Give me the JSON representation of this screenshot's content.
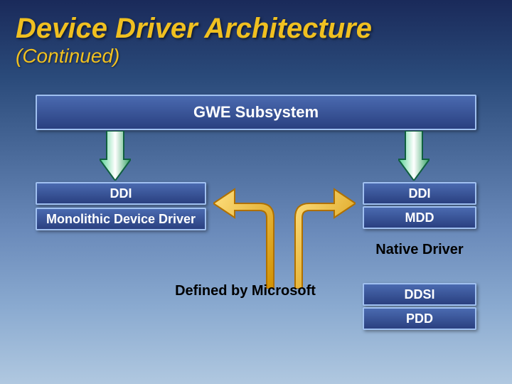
{
  "title": "Device Driver Architecture",
  "subtitle": "(Continued)",
  "blocks": {
    "gwe": "GWE Subsystem",
    "ddi_left": "DDI",
    "monolithic": "Monolithic Device Driver",
    "ddi_right": "DDI",
    "mdd": "MDD",
    "ddsi": "DDSI",
    "pdd": "PDD"
  },
  "labels": {
    "native_driver": "Native Driver",
    "defined_by_ms": "Defined by Microsoft"
  },
  "colors": {
    "arrow_fill": "#20a060",
    "arrow_stroke": "#106040",
    "bent_fill": "#f0b020",
    "bent_stroke": "#b07000",
    "title_color": "#f0c020",
    "block_border": "#a0c0f0"
  }
}
